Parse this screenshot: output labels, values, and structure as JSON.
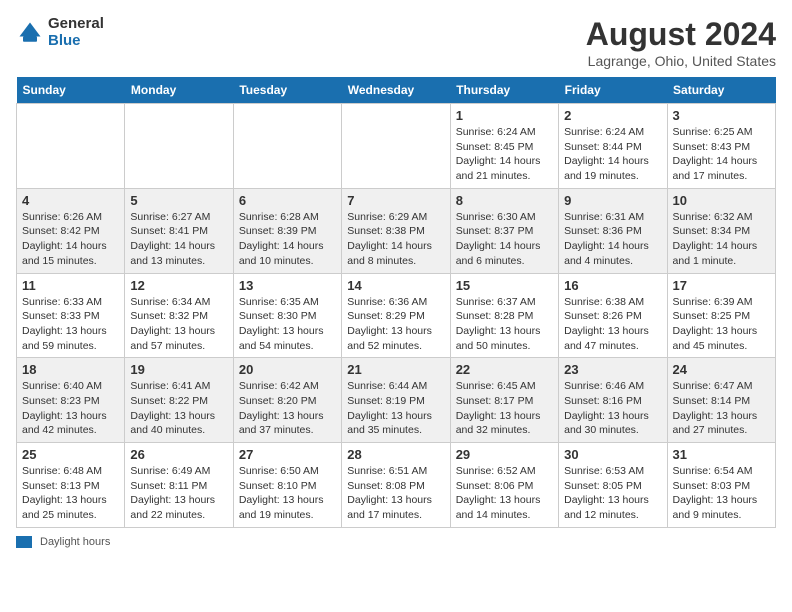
{
  "header": {
    "logo_general": "General",
    "logo_blue": "Blue",
    "title": "August 2024",
    "subtitle": "Lagrange, Ohio, United States"
  },
  "days_of_week": [
    "Sunday",
    "Monday",
    "Tuesday",
    "Wednesday",
    "Thursday",
    "Friday",
    "Saturday"
  ],
  "legend_label": "Daylight hours",
  "weeks": [
    [
      {
        "day": "",
        "info": ""
      },
      {
        "day": "",
        "info": ""
      },
      {
        "day": "",
        "info": ""
      },
      {
        "day": "",
        "info": ""
      },
      {
        "day": "1",
        "info": "Sunrise: 6:24 AM\nSunset: 8:45 PM\nDaylight: 14 hours and 21 minutes."
      },
      {
        "day": "2",
        "info": "Sunrise: 6:24 AM\nSunset: 8:44 PM\nDaylight: 14 hours and 19 minutes."
      },
      {
        "day": "3",
        "info": "Sunrise: 6:25 AM\nSunset: 8:43 PM\nDaylight: 14 hours and 17 minutes."
      }
    ],
    [
      {
        "day": "4",
        "info": "Sunrise: 6:26 AM\nSunset: 8:42 PM\nDaylight: 14 hours and 15 minutes."
      },
      {
        "day": "5",
        "info": "Sunrise: 6:27 AM\nSunset: 8:41 PM\nDaylight: 14 hours and 13 minutes."
      },
      {
        "day": "6",
        "info": "Sunrise: 6:28 AM\nSunset: 8:39 PM\nDaylight: 14 hours and 10 minutes."
      },
      {
        "day": "7",
        "info": "Sunrise: 6:29 AM\nSunset: 8:38 PM\nDaylight: 14 hours and 8 minutes."
      },
      {
        "day": "8",
        "info": "Sunrise: 6:30 AM\nSunset: 8:37 PM\nDaylight: 14 hours and 6 minutes."
      },
      {
        "day": "9",
        "info": "Sunrise: 6:31 AM\nSunset: 8:36 PM\nDaylight: 14 hours and 4 minutes."
      },
      {
        "day": "10",
        "info": "Sunrise: 6:32 AM\nSunset: 8:34 PM\nDaylight: 14 hours and 1 minute."
      }
    ],
    [
      {
        "day": "11",
        "info": "Sunrise: 6:33 AM\nSunset: 8:33 PM\nDaylight: 13 hours and 59 minutes."
      },
      {
        "day": "12",
        "info": "Sunrise: 6:34 AM\nSunset: 8:32 PM\nDaylight: 13 hours and 57 minutes."
      },
      {
        "day": "13",
        "info": "Sunrise: 6:35 AM\nSunset: 8:30 PM\nDaylight: 13 hours and 54 minutes."
      },
      {
        "day": "14",
        "info": "Sunrise: 6:36 AM\nSunset: 8:29 PM\nDaylight: 13 hours and 52 minutes."
      },
      {
        "day": "15",
        "info": "Sunrise: 6:37 AM\nSunset: 8:28 PM\nDaylight: 13 hours and 50 minutes."
      },
      {
        "day": "16",
        "info": "Sunrise: 6:38 AM\nSunset: 8:26 PM\nDaylight: 13 hours and 47 minutes."
      },
      {
        "day": "17",
        "info": "Sunrise: 6:39 AM\nSunset: 8:25 PM\nDaylight: 13 hours and 45 minutes."
      }
    ],
    [
      {
        "day": "18",
        "info": "Sunrise: 6:40 AM\nSunset: 8:23 PM\nDaylight: 13 hours and 42 minutes."
      },
      {
        "day": "19",
        "info": "Sunrise: 6:41 AM\nSunset: 8:22 PM\nDaylight: 13 hours and 40 minutes."
      },
      {
        "day": "20",
        "info": "Sunrise: 6:42 AM\nSunset: 8:20 PM\nDaylight: 13 hours and 37 minutes."
      },
      {
        "day": "21",
        "info": "Sunrise: 6:44 AM\nSunset: 8:19 PM\nDaylight: 13 hours and 35 minutes."
      },
      {
        "day": "22",
        "info": "Sunrise: 6:45 AM\nSunset: 8:17 PM\nDaylight: 13 hours and 32 minutes."
      },
      {
        "day": "23",
        "info": "Sunrise: 6:46 AM\nSunset: 8:16 PM\nDaylight: 13 hours and 30 minutes."
      },
      {
        "day": "24",
        "info": "Sunrise: 6:47 AM\nSunset: 8:14 PM\nDaylight: 13 hours and 27 minutes."
      }
    ],
    [
      {
        "day": "25",
        "info": "Sunrise: 6:48 AM\nSunset: 8:13 PM\nDaylight: 13 hours and 25 minutes."
      },
      {
        "day": "26",
        "info": "Sunrise: 6:49 AM\nSunset: 8:11 PM\nDaylight: 13 hours and 22 minutes."
      },
      {
        "day": "27",
        "info": "Sunrise: 6:50 AM\nSunset: 8:10 PM\nDaylight: 13 hours and 19 minutes."
      },
      {
        "day": "28",
        "info": "Sunrise: 6:51 AM\nSunset: 8:08 PM\nDaylight: 13 hours and 17 minutes."
      },
      {
        "day": "29",
        "info": "Sunrise: 6:52 AM\nSunset: 8:06 PM\nDaylight: 13 hours and 14 minutes."
      },
      {
        "day": "30",
        "info": "Sunrise: 6:53 AM\nSunset: 8:05 PM\nDaylight: 13 hours and 12 minutes."
      },
      {
        "day": "31",
        "info": "Sunrise: 6:54 AM\nSunset: 8:03 PM\nDaylight: 13 hours and 9 minutes."
      }
    ]
  ]
}
